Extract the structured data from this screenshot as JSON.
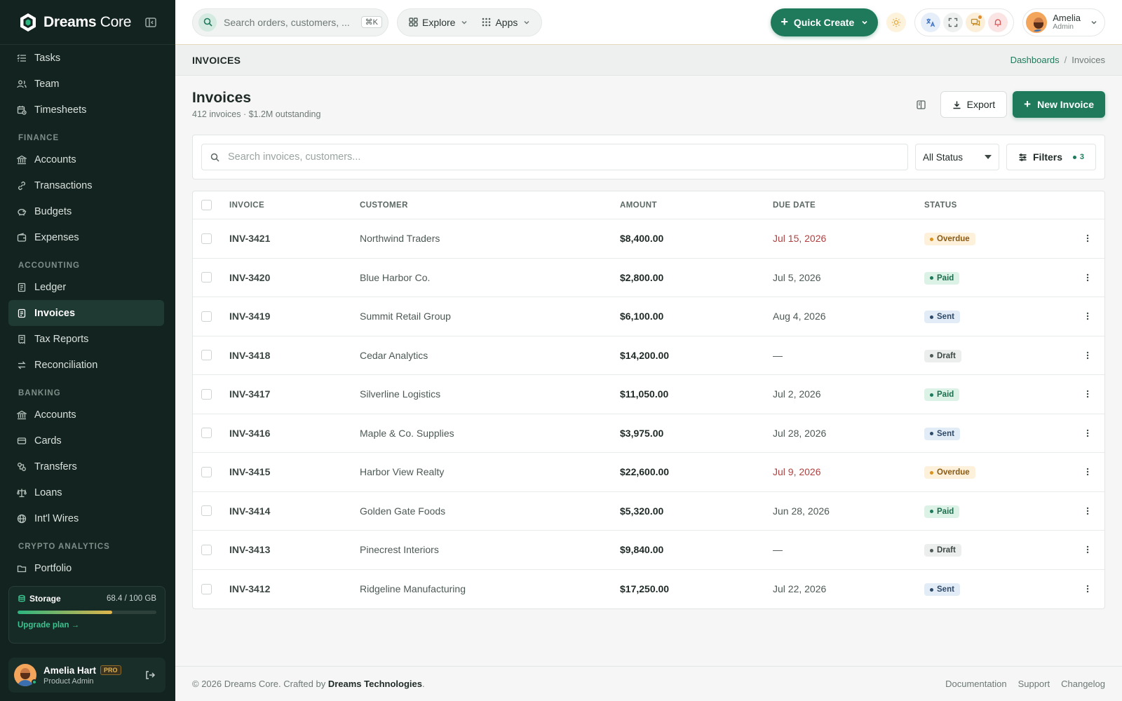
{
  "brand": {
    "name_main": "Dreams",
    "name_accent": "Core"
  },
  "sidebar": {
    "top_items": [
      {
        "label": "Tasks",
        "icon": "list-check-icon"
      },
      {
        "label": "Team",
        "icon": "users-icon"
      },
      {
        "label": "Timesheets",
        "icon": "clock-calendar-icon"
      }
    ],
    "sections": [
      {
        "title": "FINANCE",
        "items": [
          {
            "label": "Accounts",
            "icon": "bank-icon"
          },
          {
            "label": "Transactions",
            "icon": "link-icon"
          },
          {
            "label": "Budgets",
            "icon": "piggy-bank-icon"
          },
          {
            "label": "Expenses",
            "icon": "wallet-icon"
          }
        ]
      },
      {
        "title": "ACCOUNTING",
        "items": [
          {
            "label": "Ledger",
            "icon": "book-icon"
          },
          {
            "label": "Invoices",
            "icon": "invoice-icon",
            "active": true
          },
          {
            "label": "Tax Reports",
            "icon": "receipt-icon"
          },
          {
            "label": "Reconciliation",
            "icon": "swap-icon"
          }
        ]
      },
      {
        "title": "BANKING",
        "items": [
          {
            "label": "Accounts",
            "icon": "bank-icon"
          },
          {
            "label": "Cards",
            "icon": "card-icon"
          },
          {
            "label": "Transfers",
            "icon": "transfer-icon"
          },
          {
            "label": "Loans",
            "icon": "scale-icon"
          },
          {
            "label": "Int'l Wires",
            "icon": "globe-icon"
          }
        ]
      },
      {
        "title": "CRYPTO ANALYTICS",
        "items": [
          {
            "label": "Portfolio",
            "icon": "folder-icon"
          }
        ]
      }
    ],
    "storage": {
      "label": "Storage",
      "value": "68.4 / 100 GB",
      "used_fraction": 0.684,
      "upgrade": "Upgrade plan →"
    },
    "user": {
      "name": "Amelia Hart",
      "badge": "PRO",
      "role": "Product Admin"
    }
  },
  "topbar": {
    "search_placeholder": "Search orders, customers, ...",
    "shortcut": "⌘K",
    "explore": "Explore",
    "apps": "Apps",
    "quick_create": "Quick Create",
    "profile_name": "Amelia",
    "profile_role": "Admin"
  },
  "strip": {
    "title": "INVOICES",
    "crumb_link": "Dashboards",
    "crumb_sep": "/",
    "crumb_current": "Invoices"
  },
  "page": {
    "title": "Invoices",
    "subtitle": "412 invoices · $1.2M outstanding",
    "export": "Export",
    "new_invoice": "New Invoice",
    "search_placeholder": "Search invoices, customers...",
    "status_filter": "All Status",
    "filters": "Filters",
    "filter_count": "3"
  },
  "table": {
    "headers": [
      "INVOICE",
      "CUSTOMER",
      "AMOUNT",
      "DUE DATE",
      "STATUS"
    ],
    "rows": [
      {
        "invoice": "INV-3421",
        "customer": "Northwind Traders",
        "amount": "$8,400.00",
        "due": "Jul 15, 2026",
        "status": "Overdue"
      },
      {
        "invoice": "INV-3420",
        "customer": "Blue Harbor Co.",
        "amount": "$2,800.00",
        "due": "Jul 5, 2026",
        "status": "Paid"
      },
      {
        "invoice": "INV-3419",
        "customer": "Summit Retail Group",
        "amount": "$6,100.00",
        "due": "Aug 4, 2026",
        "status": "Sent"
      },
      {
        "invoice": "INV-3418",
        "customer": "Cedar Analytics",
        "amount": "$14,200.00",
        "due": "—",
        "status": "Draft"
      },
      {
        "invoice": "INV-3417",
        "customer": "Silverline Logistics",
        "amount": "$11,050.00",
        "due": "Jul 2, 2026",
        "status": "Paid"
      },
      {
        "invoice": "INV-3416",
        "customer": "Maple & Co. Supplies",
        "amount": "$3,975.00",
        "due": "Jul 28, 2026",
        "status": "Sent"
      },
      {
        "invoice": "INV-3415",
        "customer": "Harbor View Realty",
        "amount": "$22,600.00",
        "due": "Jul 9, 2026",
        "status": "Overdue"
      },
      {
        "invoice": "INV-3414",
        "customer": "Golden Gate Foods",
        "amount": "$5,320.00",
        "due": "Jun 28, 2026",
        "status": "Paid"
      },
      {
        "invoice": "INV-3413",
        "customer": "Pinecrest Interiors",
        "amount": "$9,840.00",
        "due": "—",
        "status": "Draft"
      },
      {
        "invoice": "INV-3412",
        "customer": "Ridgeline Manufacturing",
        "amount": "$17,250.00",
        "due": "Jul 22, 2026",
        "status": "Sent"
      }
    ]
  },
  "footer": {
    "copyright": "© 2026 Dreams Core. Crafted by ",
    "company": "Dreams Technologies",
    "period": ".",
    "links": [
      "Documentation",
      "Support",
      "Changelog"
    ]
  },
  "colors": {
    "sidebar_bg": "#132420",
    "accent": "#1f7a5c",
    "overdue": "#b04040"
  }
}
